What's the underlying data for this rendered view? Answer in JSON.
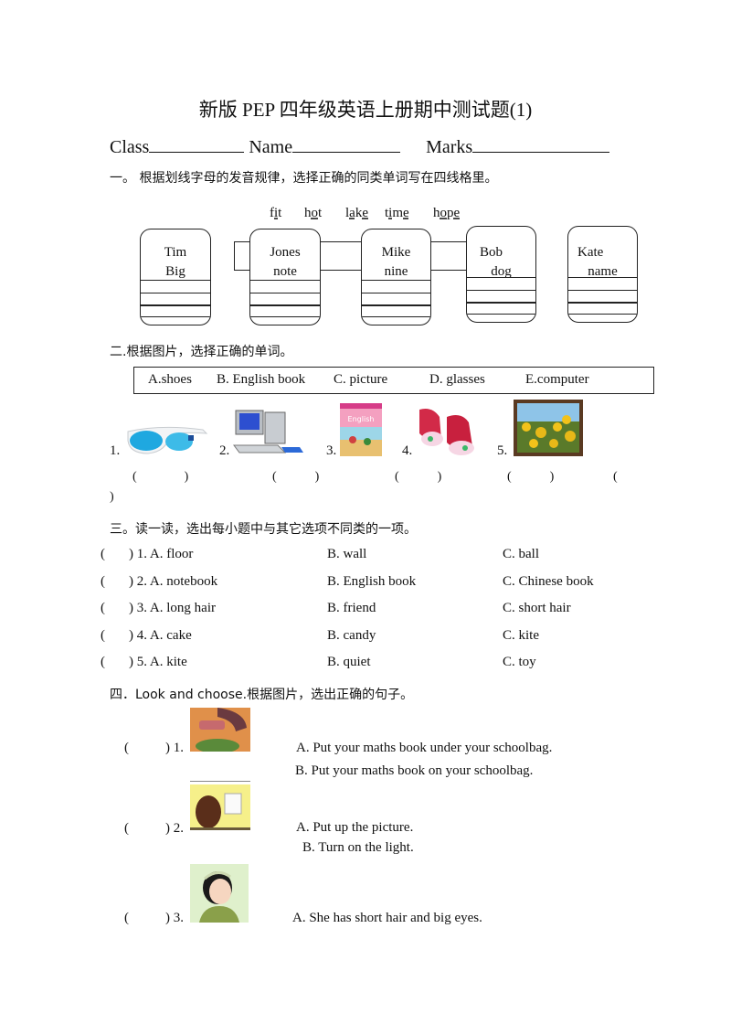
{
  "title": "新版 PEP 四年级英语上册期中测试题(1)",
  "info": {
    "class_label": "Class",
    "name_label": "Name",
    "marks_label": "Marks"
  },
  "section1": {
    "heading": "一。 根据划线字母的发音规律，选择正确的同类单词写在四线格里。",
    "words": [
      {
        "pre": "f",
        "u": "i",
        "post": "t"
      },
      {
        "pre": "h",
        "u": "o",
        "post": "t"
      },
      {
        "pre": "l",
        "u": "a",
        "mid": "k",
        "u2": "e",
        "post": ""
      },
      {
        "pre": "t",
        "u": "i",
        "mid": "m",
        "u2": "e",
        "post": ""
      },
      {
        "pre": "h",
        "u": "o",
        "mid": "p",
        "u2": "e",
        "post": ""
      }
    ],
    "boxes": [
      {
        "word1": "Tim",
        "word2": "Big"
      },
      {
        "word1": "Jones",
        "word2": "note"
      },
      {
        "word1": "Mike",
        "word2": "nine"
      },
      {
        "word1": "Bob",
        "word2": "dog"
      },
      {
        "word1": "Kate",
        "word2": "name"
      }
    ]
  },
  "section2": {
    "heading": "二.根据图片，选择正确的单词。",
    "options": [
      "A.shoes",
      "B. English book",
      "C. picture",
      "D. glasses",
      "E.computer"
    ],
    "items": [
      {
        "num": "1.",
        "icon": "sunglasses-icon"
      },
      {
        "num": "2.",
        "icon": "computer-icon"
      },
      {
        "num": "3.",
        "icon": "english-book-icon"
      },
      {
        "num": "4.",
        "icon": "shoes-icon"
      },
      {
        "num": "5.",
        "icon": "sunflower-picture-icon"
      }
    ],
    "paren_open": "(",
    "paren_close": ")"
  },
  "section3": {
    "heading": "三。读一读，选出每小题中与其它选项不同类的一项。",
    "rows": [
      {
        "num": ") 1. A. floor",
        "b": "B. wall",
        "c": "C. ball"
      },
      {
        "num": ") 2. A. notebook",
        "b": "B. English book",
        "c": "C. Chinese book"
      },
      {
        "num": ") 3. A. long hair",
        "b": "B. friend",
        "c": "C. short hair"
      },
      {
        "num": ") 4. A. cake",
        "b": "B. candy",
        "c": "C. kite"
      },
      {
        "num": ") 5. A. kite",
        "b": "B. quiet",
        "c": "C. toy"
      }
    ],
    "paren_open": "("
  },
  "section4": {
    "heading": "四．Look and choose.根据图片，选出正确的句子。",
    "items": [
      {
        "num": ") 1.",
        "a": "A. Put your maths book under your schoolbag.",
        "b": "B. Put your maths book on your schoolbag."
      },
      {
        "num": ") 2.",
        "a": "A. Put up the picture.",
        "b": "B. Turn on the light."
      },
      {
        "num": ") 3.",
        "a": "A. She has short hair and big eyes.",
        "b": ""
      }
    ],
    "paren_open": "("
  }
}
